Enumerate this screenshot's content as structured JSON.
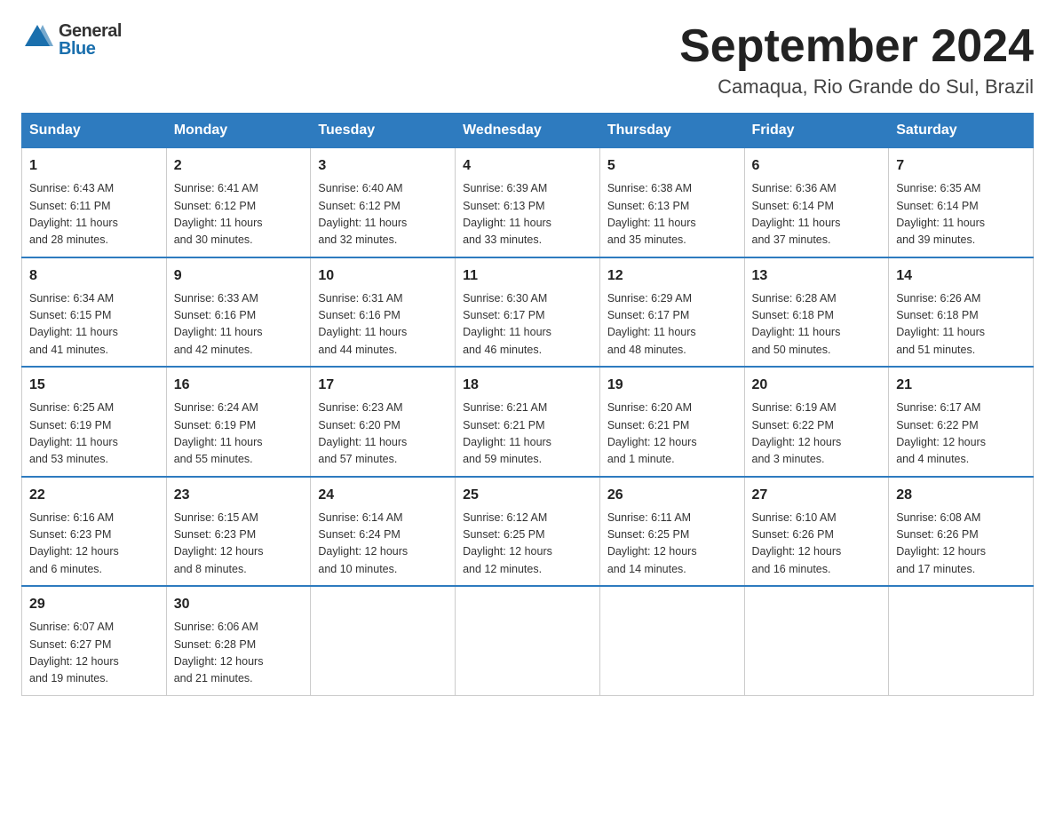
{
  "header": {
    "logo_text_general": "General",
    "logo_text_blue": "Blue",
    "title": "September 2024",
    "subtitle": "Camaqua, Rio Grande do Sul, Brazil"
  },
  "days_of_week": [
    "Sunday",
    "Monday",
    "Tuesday",
    "Wednesday",
    "Thursday",
    "Friday",
    "Saturday"
  ],
  "weeks": [
    [
      {
        "day": "1",
        "info": "Sunrise: 6:43 AM\nSunset: 6:11 PM\nDaylight: 11 hours\nand 28 minutes."
      },
      {
        "day": "2",
        "info": "Sunrise: 6:41 AM\nSunset: 6:12 PM\nDaylight: 11 hours\nand 30 minutes."
      },
      {
        "day": "3",
        "info": "Sunrise: 6:40 AM\nSunset: 6:12 PM\nDaylight: 11 hours\nand 32 minutes."
      },
      {
        "day": "4",
        "info": "Sunrise: 6:39 AM\nSunset: 6:13 PM\nDaylight: 11 hours\nand 33 minutes."
      },
      {
        "day": "5",
        "info": "Sunrise: 6:38 AM\nSunset: 6:13 PM\nDaylight: 11 hours\nand 35 minutes."
      },
      {
        "day": "6",
        "info": "Sunrise: 6:36 AM\nSunset: 6:14 PM\nDaylight: 11 hours\nand 37 minutes."
      },
      {
        "day": "7",
        "info": "Sunrise: 6:35 AM\nSunset: 6:14 PM\nDaylight: 11 hours\nand 39 minutes."
      }
    ],
    [
      {
        "day": "8",
        "info": "Sunrise: 6:34 AM\nSunset: 6:15 PM\nDaylight: 11 hours\nand 41 minutes."
      },
      {
        "day": "9",
        "info": "Sunrise: 6:33 AM\nSunset: 6:16 PM\nDaylight: 11 hours\nand 42 minutes."
      },
      {
        "day": "10",
        "info": "Sunrise: 6:31 AM\nSunset: 6:16 PM\nDaylight: 11 hours\nand 44 minutes."
      },
      {
        "day": "11",
        "info": "Sunrise: 6:30 AM\nSunset: 6:17 PM\nDaylight: 11 hours\nand 46 minutes."
      },
      {
        "day": "12",
        "info": "Sunrise: 6:29 AM\nSunset: 6:17 PM\nDaylight: 11 hours\nand 48 minutes."
      },
      {
        "day": "13",
        "info": "Sunrise: 6:28 AM\nSunset: 6:18 PM\nDaylight: 11 hours\nand 50 minutes."
      },
      {
        "day": "14",
        "info": "Sunrise: 6:26 AM\nSunset: 6:18 PM\nDaylight: 11 hours\nand 51 minutes."
      }
    ],
    [
      {
        "day": "15",
        "info": "Sunrise: 6:25 AM\nSunset: 6:19 PM\nDaylight: 11 hours\nand 53 minutes."
      },
      {
        "day": "16",
        "info": "Sunrise: 6:24 AM\nSunset: 6:19 PM\nDaylight: 11 hours\nand 55 minutes."
      },
      {
        "day": "17",
        "info": "Sunrise: 6:23 AM\nSunset: 6:20 PM\nDaylight: 11 hours\nand 57 minutes."
      },
      {
        "day": "18",
        "info": "Sunrise: 6:21 AM\nSunset: 6:21 PM\nDaylight: 11 hours\nand 59 minutes."
      },
      {
        "day": "19",
        "info": "Sunrise: 6:20 AM\nSunset: 6:21 PM\nDaylight: 12 hours\nand 1 minute."
      },
      {
        "day": "20",
        "info": "Sunrise: 6:19 AM\nSunset: 6:22 PM\nDaylight: 12 hours\nand 3 minutes."
      },
      {
        "day": "21",
        "info": "Sunrise: 6:17 AM\nSunset: 6:22 PM\nDaylight: 12 hours\nand 4 minutes."
      }
    ],
    [
      {
        "day": "22",
        "info": "Sunrise: 6:16 AM\nSunset: 6:23 PM\nDaylight: 12 hours\nand 6 minutes."
      },
      {
        "day": "23",
        "info": "Sunrise: 6:15 AM\nSunset: 6:23 PM\nDaylight: 12 hours\nand 8 minutes."
      },
      {
        "day": "24",
        "info": "Sunrise: 6:14 AM\nSunset: 6:24 PM\nDaylight: 12 hours\nand 10 minutes."
      },
      {
        "day": "25",
        "info": "Sunrise: 6:12 AM\nSunset: 6:25 PM\nDaylight: 12 hours\nand 12 minutes."
      },
      {
        "day": "26",
        "info": "Sunrise: 6:11 AM\nSunset: 6:25 PM\nDaylight: 12 hours\nand 14 minutes."
      },
      {
        "day": "27",
        "info": "Sunrise: 6:10 AM\nSunset: 6:26 PM\nDaylight: 12 hours\nand 16 minutes."
      },
      {
        "day": "28",
        "info": "Sunrise: 6:08 AM\nSunset: 6:26 PM\nDaylight: 12 hours\nand 17 minutes."
      }
    ],
    [
      {
        "day": "29",
        "info": "Sunrise: 6:07 AM\nSunset: 6:27 PM\nDaylight: 12 hours\nand 19 minutes."
      },
      {
        "day": "30",
        "info": "Sunrise: 6:06 AM\nSunset: 6:28 PM\nDaylight: 12 hours\nand 21 minutes."
      },
      {
        "day": "",
        "info": ""
      },
      {
        "day": "",
        "info": ""
      },
      {
        "day": "",
        "info": ""
      },
      {
        "day": "",
        "info": ""
      },
      {
        "day": "",
        "info": ""
      }
    ]
  ]
}
